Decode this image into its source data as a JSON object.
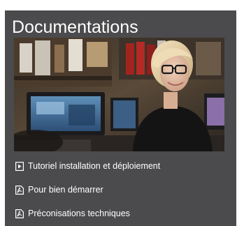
{
  "panel": {
    "title": "Documentations",
    "colors": {
      "background": "#4b4b4d",
      "text": "#ffffff"
    }
  },
  "hero_image": {
    "icon": "photo-woman-at-office-desk"
  },
  "documents": [
    {
      "label": "Tutoriel installation et déploiement",
      "icon": "video-file-icon"
    },
    {
      "label": "Pour bien démarrer",
      "icon": "pdf-file-icon"
    },
    {
      "label": "Préconisations techniques",
      "icon": "pdf-file-icon"
    }
  ]
}
